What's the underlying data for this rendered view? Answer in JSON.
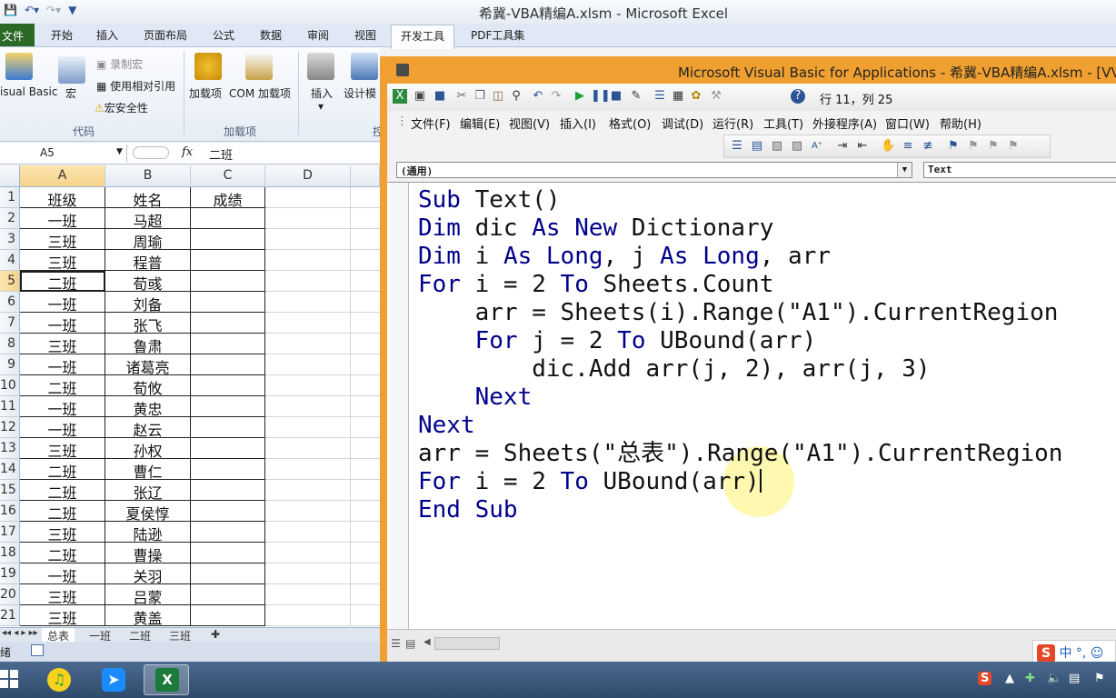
{
  "excel": {
    "title": "希冀-VBA精编A.xlsm - Microsoft Excel",
    "tabs": [
      "文件",
      "开始",
      "插入",
      "页面布局",
      "公式",
      "数据",
      "审阅",
      "视图",
      "开发工具",
      "PDF工具集"
    ],
    "active_tab": "开发工具",
    "ribbon": {
      "visual_basic": "isual Basic",
      "macro": "宏",
      "record_macro": "录制宏",
      "relative_ref": "使用相对引用",
      "macro_security": "宏安全性",
      "group_code": "代码",
      "addins": "加载项",
      "com_addins": "COM 加载项",
      "group_addins": "加载项",
      "insert": "插入",
      "design_mode": "设计模",
      "cut_off_label": "控"
    },
    "name_box": "A5",
    "fx": "fx",
    "formula_value": "二班",
    "columns": [
      "A",
      "B",
      "C",
      "D"
    ],
    "rows": [
      {
        "n": "1",
        "a": "班级",
        "b": "姓名",
        "c": "成绩"
      },
      {
        "n": "2",
        "a": "一班",
        "b": "马超",
        "c": ""
      },
      {
        "n": "3",
        "a": "三班",
        "b": "周瑜",
        "c": ""
      },
      {
        "n": "4",
        "a": "三班",
        "b": "程普",
        "c": ""
      },
      {
        "n": "5",
        "a": "二班",
        "b": "荀彧",
        "c": ""
      },
      {
        "n": "6",
        "a": "一班",
        "b": "刘备",
        "c": ""
      },
      {
        "n": "7",
        "a": "一班",
        "b": "张飞",
        "c": ""
      },
      {
        "n": "8",
        "a": "三班",
        "b": "鲁肃",
        "c": ""
      },
      {
        "n": "9",
        "a": "一班",
        "b": "诸葛亮",
        "c": ""
      },
      {
        "n": "10",
        "a": "二班",
        "b": "荀攸",
        "c": ""
      },
      {
        "n": "11",
        "a": "一班",
        "b": "黄忠",
        "c": ""
      },
      {
        "n": "12",
        "a": "一班",
        "b": "赵云",
        "c": ""
      },
      {
        "n": "13",
        "a": "三班",
        "b": "孙权",
        "c": ""
      },
      {
        "n": "14",
        "a": "二班",
        "b": "曹仁",
        "c": ""
      },
      {
        "n": "15",
        "a": "二班",
        "b": "张辽",
        "c": ""
      },
      {
        "n": "16",
        "a": "二班",
        "b": "夏侯惇",
        "c": ""
      },
      {
        "n": "17",
        "a": "三班",
        "b": "陆逊",
        "c": ""
      },
      {
        "n": "18",
        "a": "二班",
        "b": "曹操",
        "c": ""
      },
      {
        "n": "19",
        "a": "一班",
        "b": "关羽",
        "c": ""
      },
      {
        "n": "20",
        "a": "三班",
        "b": "吕蒙",
        "c": ""
      },
      {
        "n": "21",
        "a": "三班",
        "b": "黄盖",
        "c": ""
      }
    ],
    "sheet_tabs": [
      "总表",
      "一班",
      "二班",
      "三班"
    ],
    "status_text": "绪"
  },
  "vbe": {
    "title": "Microsoft Visual Basic for Applications - 希冀-VBA精编A.xlsm - [VVV",
    "position": "行 11，列 25",
    "menu": [
      "文件(F)",
      "编辑(E)",
      "视图(V)",
      "插入(I)",
      "格式(O)",
      "调试(D)",
      "运行(R)",
      "工具(T)",
      "外接程序(A)",
      "窗口(W)",
      "帮助(H)"
    ],
    "object_combo": "(通用)",
    "proc_combo": "Text",
    "code_lines": [
      "Sub Text()",
      "Dim dic As New Dictionary",
      "Dim i As Long, j As Long, arr",
      "For i = 2 To Sheets.Count",
      "    arr = Sheets(i).Range(\"A1\").CurrentRegion",
      "    For j = 2 To UBound(arr)",
      "        dic.Add arr(j, 2), arr(j, 3)",
      "    Next",
      "Next",
      "arr = Sheets(\"总表\").Range(\"A1\").CurrentRegion",
      "For i = 2 To UBound(arr)",
      "End Sub"
    ],
    "ime_label": "中"
  }
}
